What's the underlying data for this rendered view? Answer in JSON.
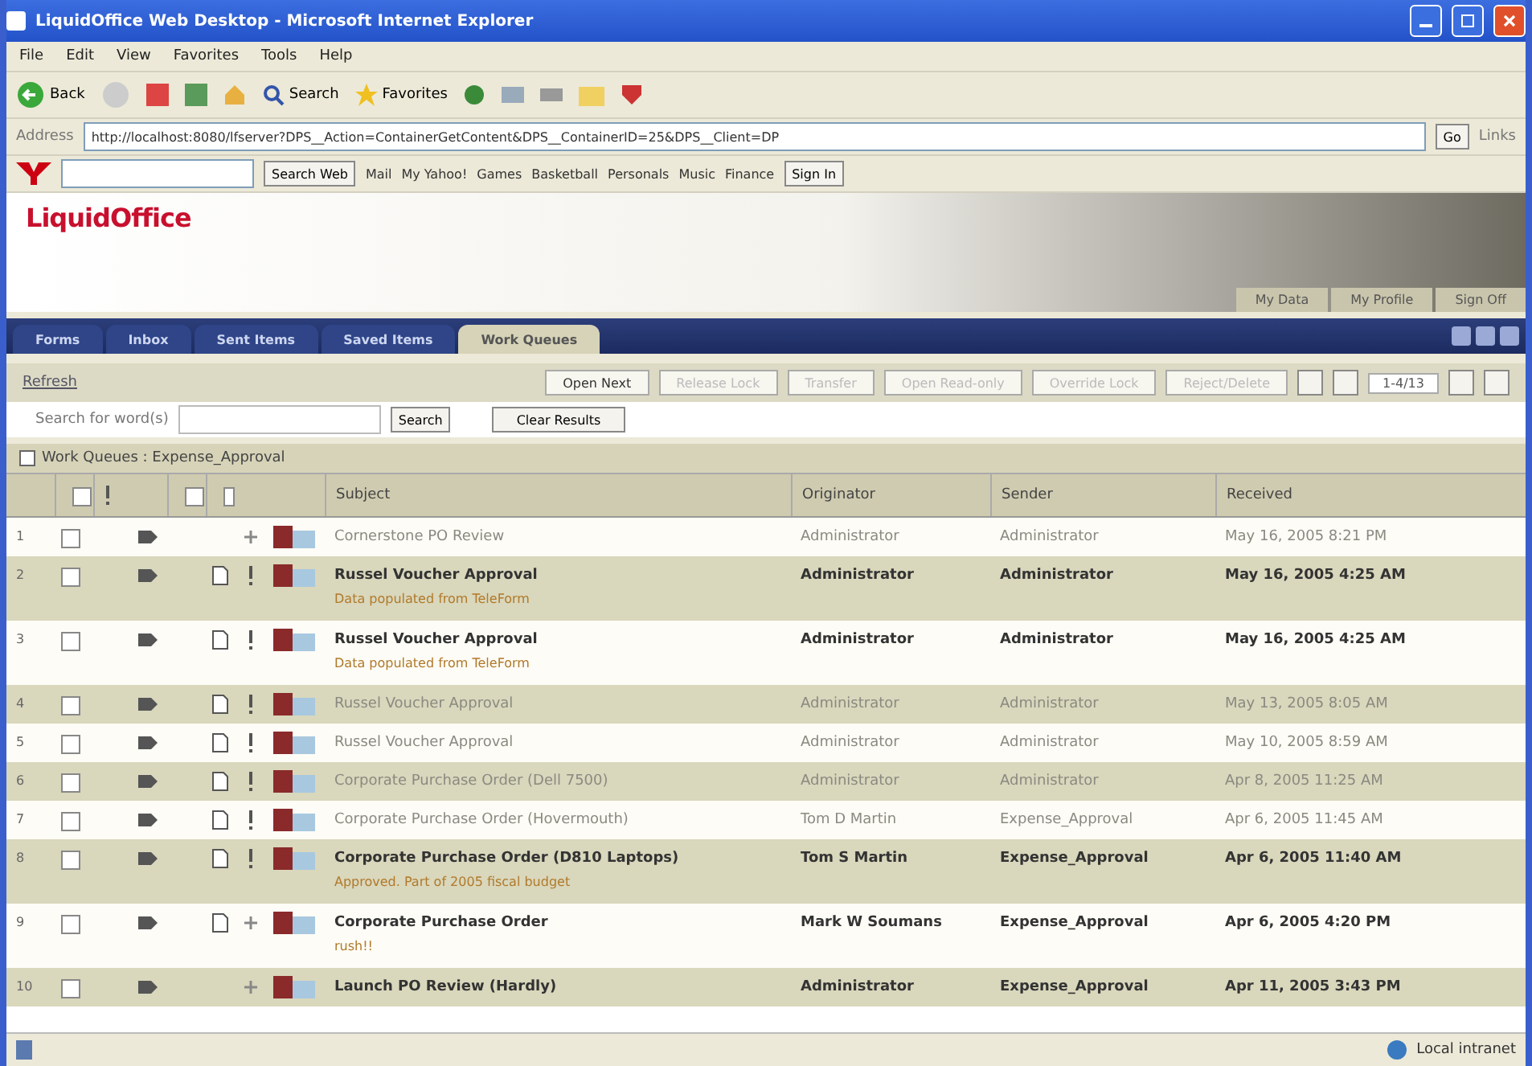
{
  "window": {
    "title": "LiquidOffice Web Desktop - Microsoft Internet Explorer"
  },
  "menu": [
    "File",
    "Edit",
    "View",
    "Favorites",
    "Tools",
    "Help"
  ],
  "toolbar": {
    "back": "Back",
    "search": "Search",
    "favorites": "Favorites"
  },
  "address": {
    "label": "Address",
    "url": "http://localhost:8080/lfserver?DPS__Action=ContainerGetContent&DPS__ContainerID=25&DPS__Client=DP",
    "go": "Go",
    "links": "Links"
  },
  "yahoo_bar": {
    "search_button": "Search Web",
    "items": [
      "Mail",
      "My Yahoo!",
      "Games",
      "Basketball",
      "Personals",
      "Music",
      "Finance"
    ],
    "sign_in": "Sign In"
  },
  "header": {
    "logo": "LiquidOffice",
    "links": [
      "My Data",
      "My Profile",
      "Sign Off"
    ]
  },
  "tabs": [
    {
      "label": "Forms",
      "selected": false
    },
    {
      "label": "Inbox",
      "selected": false
    },
    {
      "label": "Sent Items",
      "selected": false
    },
    {
      "label": "Saved Items",
      "selected": false
    },
    {
      "label": "Work Queues",
      "selected": true
    }
  ],
  "actions": {
    "refresh": "Refresh",
    "buttons": [
      {
        "label": "Open Next",
        "disabled": false
      },
      {
        "label": "Release Lock",
        "disabled": true
      },
      {
        "label": "Transfer",
        "disabled": true
      },
      {
        "label": "Open Read-only",
        "disabled": true
      },
      {
        "label": "Override Lock",
        "disabled": true
      },
      {
        "label": "Reject/Delete",
        "disabled": true
      }
    ],
    "page": "1-4/13"
  },
  "search": {
    "label": "Search for word(s)",
    "button": "Search",
    "clear": "Clear Results"
  },
  "breadcrumb": "Work Queues : Expense_Approval",
  "table": {
    "select_all_checked": false,
    "columns": [
      "Subject",
      "Originator",
      "Sender",
      "Received"
    ],
    "rows": [
      {
        "number": "1",
        "checked": false,
        "unread": false,
        "attachment": false,
        "priority": false,
        "subject": "Cornerstone PO Review",
        "originator": "Administrator",
        "sender": "Administrator",
        "received": "May 16, 2005 8:21 PM"
      },
      {
        "number": "2",
        "checked": false,
        "unread": true,
        "attachment": true,
        "priority": true,
        "subject": "Russel Voucher Approval",
        "note": "Data populated from TeleForm",
        "originator": "Administrator",
        "sender": "Administrator",
        "received": "May 16, 2005 4:25 AM"
      },
      {
        "number": "3",
        "checked": false,
        "unread": true,
        "attachment": true,
        "priority": true,
        "subject": "Russel Voucher Approval",
        "note": "Data populated from TeleForm",
        "originator": "Administrator",
        "sender": "Administrator",
        "received": "May 16, 2005 4:25 AM"
      },
      {
        "number": "4",
        "checked": false,
        "unread": false,
        "attachment": true,
        "priority": true,
        "subject": "Russel Voucher Approval",
        "originator": "Administrator",
        "sender": "Administrator",
        "received": "May 13, 2005 8:05 AM"
      },
      {
        "number": "5",
        "checked": false,
        "unread": false,
        "attachment": true,
        "priority": true,
        "subject": "Russel Voucher Approval",
        "originator": "Administrator",
        "sender": "Administrator",
        "received": "May 10, 2005 8:59 AM"
      },
      {
        "number": "6",
        "checked": false,
        "unread": false,
        "attachment": true,
        "priority": true,
        "subject": "Corporate Purchase Order (Dell 7500)",
        "originator": "Administrator",
        "sender": "Administrator",
        "received": "Apr 8, 2005 11:25 AM"
      },
      {
        "number": "7",
        "checked": false,
        "unread": false,
        "attachment": true,
        "priority": true,
        "subject": "Corporate Purchase Order (Hovermouth)",
        "originator": "Tom D Martin",
        "sender": "Expense_Approval",
        "received": "Apr 6, 2005 11:45 AM"
      },
      {
        "number": "8",
        "checked": false,
        "unread": true,
        "attachment": true,
        "priority": true,
        "subject": "Corporate Purchase Order (D810 Laptops)",
        "note": "Approved. Part of 2005 fiscal budget",
        "originator": "Tom S Martin",
        "sender": "Expense_Approval",
        "received": "Apr 6, 2005 11:40 AM"
      },
      {
        "number": "9",
        "checked": false,
        "unread": true,
        "attachment": true,
        "priority": false,
        "subject": "Corporate Purchase Order",
        "note": "rush!!",
        "originator": "Mark W Soumans",
        "sender": "Expense_Approval",
        "received": "Apr 6, 2005 4:20 PM"
      },
      {
        "number": "10",
        "checked": false,
        "unread": true,
        "attachment": false,
        "priority": false,
        "subject": "Launch PO Review (Hardly)",
        "originator": "Administrator",
        "sender": "Expense_Approval",
        "received": "Apr 11, 2005 3:43 PM"
      }
    ]
  },
  "status_bar": {
    "zone": "Local intranet"
  }
}
